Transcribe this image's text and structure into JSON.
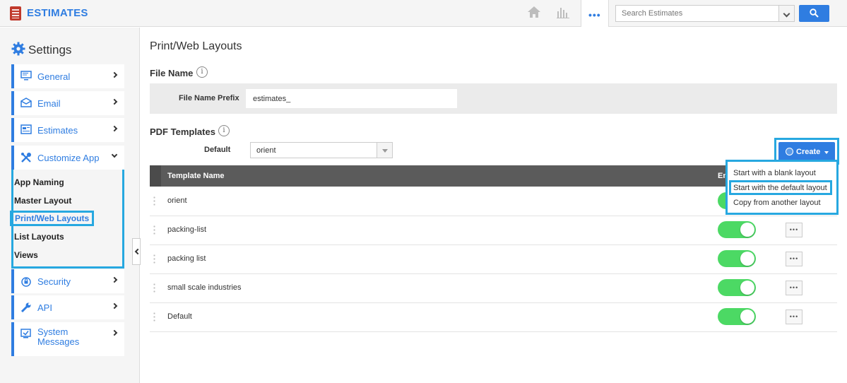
{
  "app": {
    "title": "ESTIMATES",
    "brand_color": "#2f7de1",
    "logo_icon": "calculator-icon"
  },
  "topbar": {
    "home_icon": "home-icon",
    "reports_icon": "bar-chart-icon",
    "more_label": "•••",
    "search": {
      "placeholder": "Search Estimates",
      "dropdown_icon": "chevron-down-icon",
      "button_icon": "search-icon"
    }
  },
  "sidebar": {
    "title": "Settings",
    "items": [
      {
        "label": "General",
        "icon": "monitor-icon"
      },
      {
        "label": "Email",
        "icon": "envelope-icon"
      },
      {
        "label": "Estimates",
        "icon": "document-icon"
      },
      {
        "label": "Customize App",
        "icon": "tools-icon"
      },
      {
        "label": "Security",
        "icon": "lock-icon"
      },
      {
        "label": "API",
        "icon": "wrench-icon"
      },
      {
        "label": "System Messages",
        "icon": "checkbox-icon"
      }
    ],
    "customize_sub": [
      "App Naming",
      "Master Layout",
      "Print/Web Layouts",
      "List Layouts",
      "Views"
    ],
    "active_sub": "Print/Web Layouts"
  },
  "main": {
    "title": "Print/Web Layouts",
    "file_name": {
      "section_title": "File Name",
      "prefix_label": "File Name Prefix",
      "prefix_value": "estimates_"
    },
    "pdf_templates": {
      "section_title": "PDF Templates",
      "default_label": "Default",
      "default_value": "orient",
      "create_label": "Create",
      "create_menu": [
        "Start with a blank layout",
        "Start with the default layout",
        "Copy from another layout"
      ],
      "highlighted_menu_item": "Start with the default layout",
      "columns": [
        "Template Name",
        "En"
      ],
      "rows": [
        {
          "name": "orient",
          "enabled": true
        },
        {
          "name": "packing-list",
          "enabled": true
        },
        {
          "name": "packing list",
          "enabled": true
        },
        {
          "name": "small scale industries",
          "enabled": true
        },
        {
          "name": "Default",
          "enabled": true
        }
      ],
      "more_label": "•••",
      "toggle_color": "#4cd964"
    }
  }
}
